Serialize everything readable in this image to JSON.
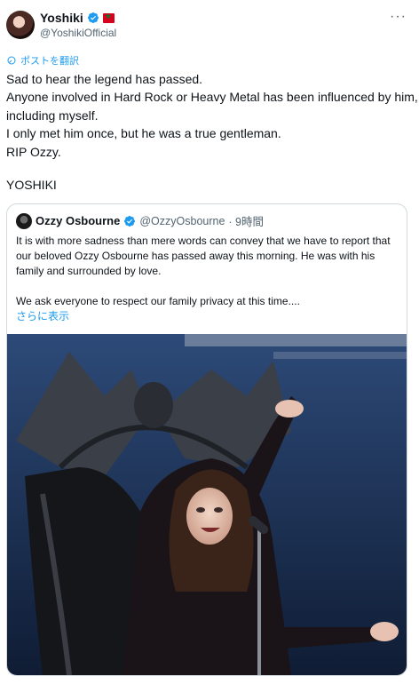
{
  "author": {
    "display_name": "Yoshiki",
    "handle": "@YoshikiOfficial",
    "avatar": "profile-photo",
    "verified": true
  },
  "translate_label": "ポストを翻訳",
  "tweet_lines": [
    "Sad to hear the legend has passed.",
    "Anyone involved in Hard Rock or Heavy Metal has been influenced by him,",
    "including myself.",
    "I only met him once, but he was a true gentleman.",
    "RIP Ozzy."
  ],
  "signature": "YOSHIKI",
  "quoted": {
    "display_name": "Ozzy Osbourne",
    "handle": "@OzzyOsbourne",
    "time": "· 9時間",
    "verified": true,
    "lines": [
      "It is with more sadness than mere words can convey that we have to report that",
      "our beloved Ozzy Osbourne has passed away this morning. He was with his",
      "family and surrounded by love."
    ],
    "line_after_break": "We ask everyone to respect our family privacy at this time....",
    "show_more": "さらに表示",
    "media": "photo of performer on bat-winged throne on stage"
  },
  "colors": {
    "link": "#1d9bf0",
    "muted": "#536471",
    "border": "#cfd9de",
    "verified": "#1d9bf0"
  }
}
